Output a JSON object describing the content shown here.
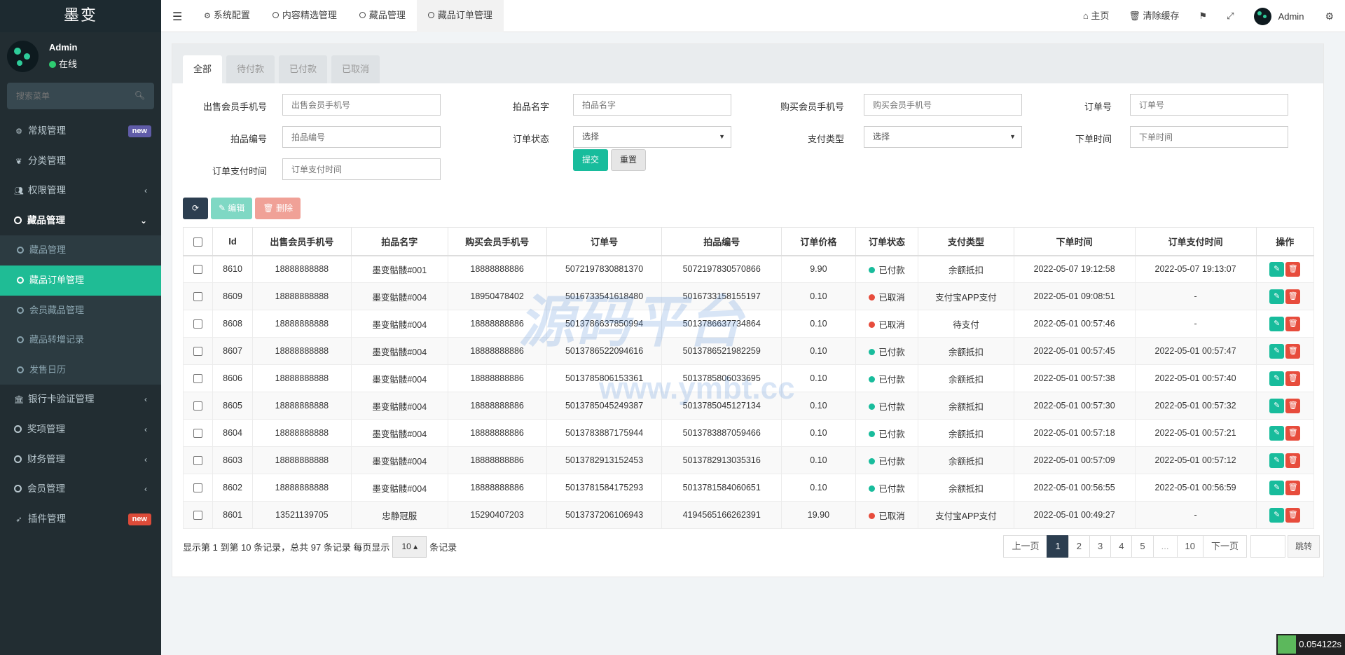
{
  "sidebar": {
    "logo": "墨变",
    "user_name": "Admin",
    "user_status": "在线",
    "search_placeholder": "搜索菜单",
    "items": [
      {
        "label": "常规管理",
        "icon": "cogs-icon",
        "badge": "new",
        "badge_color": "#605ca8"
      },
      {
        "label": "分类管理",
        "icon": "leaf-icon"
      },
      {
        "label": "权限管理",
        "icon": "users-icon",
        "arrow": "‹"
      },
      {
        "label": "藏品管理",
        "icon": "circle-icon",
        "arrow": "⌄"
      },
      {
        "label": "藏品管理",
        "icon": "circle-icon",
        "sub": true
      },
      {
        "label": "藏品订单管理",
        "icon": "circle-icon",
        "sub": true,
        "active": true
      },
      {
        "label": "会员藏品管理",
        "icon": "circle-icon",
        "sub": true
      },
      {
        "label": "藏品转增记录",
        "icon": "circle-icon",
        "sub": true
      },
      {
        "label": "发售日历",
        "icon": "circle-icon",
        "sub": true
      },
      {
        "label": "银行卡验证管理",
        "icon": "bank-icon",
        "arrow": "‹"
      },
      {
        "label": "奖项管理",
        "icon": "circle-icon",
        "arrow": "‹"
      },
      {
        "label": "财务管理",
        "icon": "circle-icon",
        "arrow": "‹"
      },
      {
        "label": "会员管理",
        "icon": "circle-icon",
        "arrow": "‹"
      },
      {
        "label": "插件管理",
        "icon": "rocket-icon",
        "badge": "new",
        "badge_color": "#dd4b39"
      }
    ]
  },
  "topbar": {
    "tabs": [
      {
        "label": "系统配置",
        "icon": "gear-icon"
      },
      {
        "label": "内容精选管理",
        "icon": "circle-icon"
      },
      {
        "label": "藏品管理",
        "icon": "circle-icon"
      },
      {
        "label": "藏品订单管理",
        "icon": "circle-icon",
        "active": true
      }
    ],
    "home": "主页",
    "clear_cache": "清除缓存",
    "admin": "Admin"
  },
  "content_tabs": [
    "全部",
    "待付款",
    "已付款",
    "已取消"
  ],
  "filters": {
    "seller_phone_label": "出售会员手机号",
    "seller_phone_ph": "出售会员手机号",
    "item_name_label": "拍品名字",
    "item_name_ph": "拍品名字",
    "buyer_phone_label": "购买会员手机号",
    "buyer_phone_ph": "购买会员手机号",
    "order_no_label": "订单号",
    "order_no_ph": "订单号",
    "item_no_label": "拍品编号",
    "item_no_ph": "拍品编号",
    "order_status_label": "订单状态",
    "order_status_value": "选择",
    "pay_type_label": "支付类型",
    "pay_type_value": "选择",
    "order_time_label": "下单时间",
    "order_time_ph": "下单时间",
    "pay_time_label": "订单支付时间",
    "pay_time_ph": "订单支付时间",
    "submit": "提交",
    "reset": "重置"
  },
  "toolbar": {
    "edit": "编辑",
    "delete": "删除"
  },
  "table": {
    "headers": [
      "Id",
      "出售会员手机号",
      "拍品名字",
      "购买会员手机号",
      "订单号",
      "拍品编号",
      "订单价格",
      "订单状态",
      "支付类型",
      "下单时间",
      "订单支付时间",
      "操作"
    ],
    "rows": [
      [
        "8610",
        "18888888888",
        "墨变骷髅#001",
        "18888888886",
        "5072197830881370",
        "5072197830570866",
        "9.90",
        "已付款",
        "余额抵扣",
        "2022-05-07 19:12:58",
        "2022-05-07 19:13:07"
      ],
      [
        "8609",
        "18888888888",
        "墨变骷髅#004",
        "18950478402",
        "5016733541618480",
        "5016733158155197",
        "0.10",
        "已取消",
        "支付宝APP支付",
        "2022-05-01 09:08:51",
        "-"
      ],
      [
        "8608",
        "18888888888",
        "墨变骷髅#004",
        "18888888886",
        "5013786637850994",
        "5013786637734864",
        "0.10",
        "已取消",
        "待支付",
        "2022-05-01 00:57:46",
        "-"
      ],
      [
        "8607",
        "18888888888",
        "墨变骷髅#004",
        "18888888886",
        "5013786522094616",
        "5013786521982259",
        "0.10",
        "已付款",
        "余额抵扣",
        "2022-05-01 00:57:45",
        "2022-05-01 00:57:47"
      ],
      [
        "8606",
        "18888888888",
        "墨变骷髅#004",
        "18888888886",
        "5013785806153361",
        "5013785806033695",
        "0.10",
        "已付款",
        "余额抵扣",
        "2022-05-01 00:57:38",
        "2022-05-01 00:57:40"
      ],
      [
        "8605",
        "18888888888",
        "墨变骷髅#004",
        "18888888886",
        "5013785045249387",
        "5013785045127134",
        "0.10",
        "已付款",
        "余额抵扣",
        "2022-05-01 00:57:30",
        "2022-05-01 00:57:32"
      ],
      [
        "8604",
        "18888888888",
        "墨变骷髅#004",
        "18888888886",
        "5013783887175944",
        "5013783887059466",
        "0.10",
        "已付款",
        "余额抵扣",
        "2022-05-01 00:57:18",
        "2022-05-01 00:57:21"
      ],
      [
        "8603",
        "18888888888",
        "墨变骷髅#004",
        "18888888886",
        "5013782913152453",
        "5013782913035316",
        "0.10",
        "已付款",
        "余额抵扣",
        "2022-05-01 00:57:09",
        "2022-05-01 00:57:12"
      ],
      [
        "8602",
        "18888888888",
        "墨变骷髅#004",
        "18888888886",
        "5013781584175293",
        "5013781584060651",
        "0.10",
        "已付款",
        "余额抵扣",
        "2022-05-01 00:56:55",
        "2022-05-01 00:56:59"
      ],
      [
        "8601",
        "13521139705",
        "忠静冠服",
        "15290407203",
        "5013737206106943",
        "4194565166262391",
        "19.90",
        "已取消",
        "支付宝APP支付",
        "2022-05-01 00:49:27",
        "-"
      ]
    ]
  },
  "pagination": {
    "info_prefix": "显示第 1 到第 10 条记录，总共 97 条记录 每页显示",
    "page_size": "10",
    "info_suffix": "条记录",
    "prev": "上一页",
    "pages": [
      "1",
      "2",
      "3",
      "4",
      "5",
      "...",
      "10"
    ],
    "next": "下一页",
    "jump": "跳转"
  },
  "watermark": {
    "main": "源码平台",
    "sub": "www.ymbt.cc"
  },
  "timer": "0.054122s",
  "colors": {
    "accent": "#18bc9c",
    "danger": "#e74c3c",
    "sidebar": "#222d32",
    "pager_active": "#2c3e50"
  }
}
